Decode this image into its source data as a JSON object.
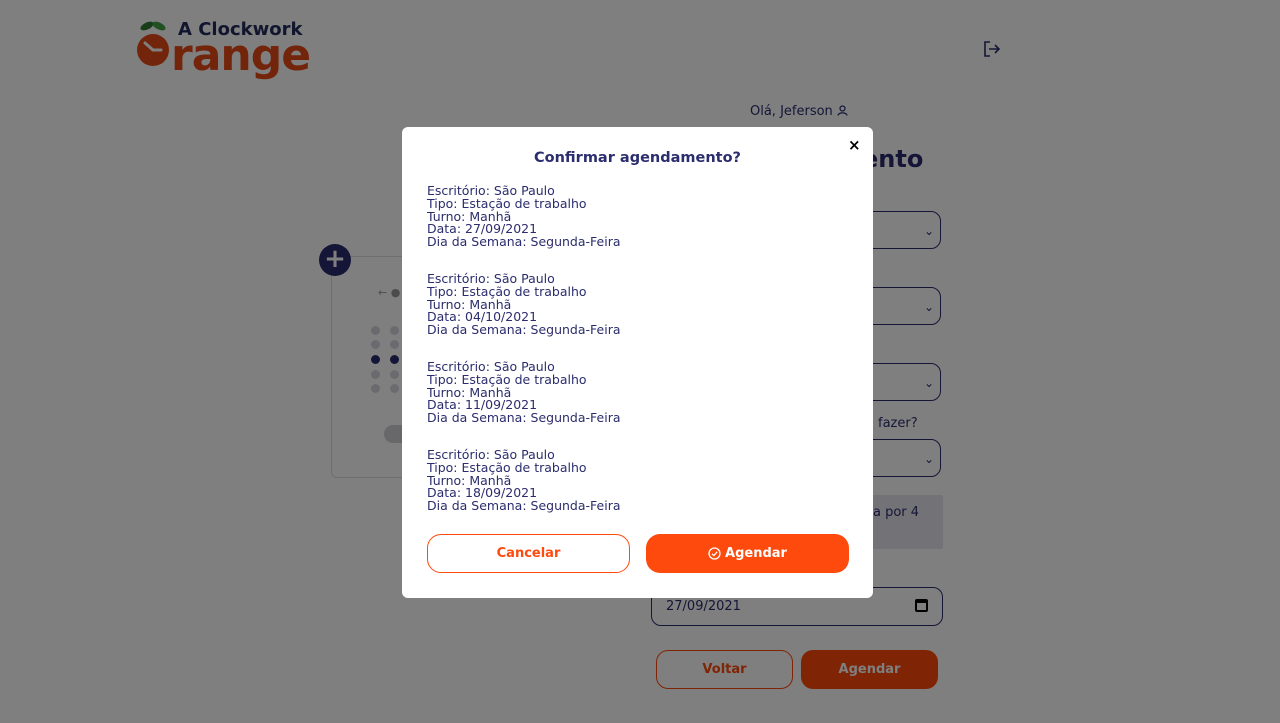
{
  "brand": {
    "top": "A Clockwork",
    "word": "Orange",
    "colors": {
      "accent": "#ff4a0d",
      "navy": "#2b2d6e"
    }
  },
  "header": {
    "greeting": "Olá, Jeferson",
    "logout_icon": "logout-icon"
  },
  "background_form": {
    "title_fragment": "ento",
    "label_fragment": "fazer?",
    "info_fragment": "a por 4",
    "date_value": "27/09/2021",
    "back_label": "Voltar",
    "schedule_label": "Agendar"
  },
  "modal": {
    "title": "Confirmar agendamento?",
    "entries": [
      {
        "office": "Escritório: São Paulo",
        "type": "Tipo: Estação de trabalho",
        "shift": "Turno: Manhã",
        "date": "Data: 27/09/2021",
        "weekday": "Dia da Semana: Segunda-Feira"
      },
      {
        "office": "Escritório: São Paulo",
        "type": "Tipo: Estação de trabalho",
        "shift": "Turno: Manhã",
        "date": "Data: 04/10/2021",
        "weekday": "Dia da Semana: Segunda-Feira"
      },
      {
        "office": "Escritório: São Paulo",
        "type": "Tipo: Estação de trabalho",
        "shift": "Turno: Manhã",
        "date": "Data: 11/09/2021",
        "weekday": "Dia da Semana: Segunda-Feira"
      },
      {
        "office": "Escritório: São Paulo",
        "type": "Tipo: Estação de trabalho",
        "shift": "Turno: Manhã",
        "date": "Data: 18/09/2021",
        "weekday": "Dia da Semana: Segunda-Feira"
      }
    ],
    "cancel_label": "Cancelar",
    "confirm_label": "Agendar"
  }
}
